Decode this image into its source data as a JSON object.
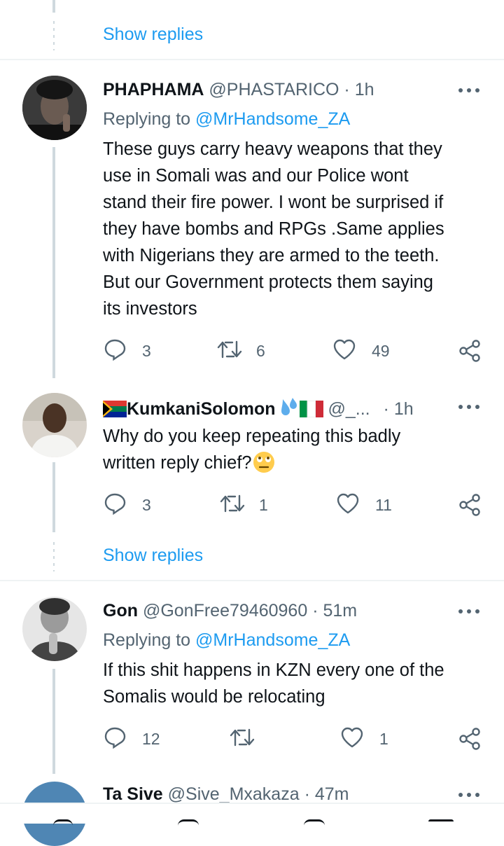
{
  "threads": [
    {
      "show_replies": "Show replies"
    },
    {
      "name": "PHAPHAMA",
      "handle": "@PHASTARICO",
      "time": "· 1h",
      "replying_prefix": "Replying to",
      "replying_to": "@MrHandsome_ZA",
      "text_lines": [
        "These guys carry heavy weapons that they",
        "use in Somali was and our Police wont",
        "stand their fire power. I wont be surprised if",
        "they have bombs and RPGs .Same applies",
        "with Nigerians they are armed to the teeth.",
        "But our Government protects them saying",
        "its investors"
      ],
      "replies": "3",
      "retweets": "6",
      "likes": "49"
    },
    {
      "name": "KumkaniSolomon",
      "handle": "@_...",
      "time": "· 1h",
      "text": "Why do you keep repeating this badly",
      "text2": "written reply chief?",
      "replies": "3",
      "retweets": "1",
      "likes": "11"
    },
    {
      "show_replies": "Show replies"
    },
    {
      "name": "Gon",
      "handle": "@GonFree79460960",
      "time": "· 51m",
      "replying_prefix": "Replying to",
      "replying_to": "@MrHandsome_ZA",
      "text_lines": [
        "If this shit happens in KZN every one of the",
        "Somalis would be relocating"
      ],
      "replies": "12",
      "retweets": "",
      "likes": "1"
    },
    {
      "name": "Ta Sive",
      "handle": "@Sive_Mxakaza",
      "time": "· 47m"
    }
  ],
  "icons": {
    "reply": "reply-icon",
    "retweet": "retweet-icon",
    "like": "heart-icon",
    "share": "share-icon",
    "more": "more-dots-icon"
  },
  "colors": {
    "link": "#1d9bf0",
    "muted": "#536471",
    "text": "#0f1419",
    "thread_line": "#cfd9de"
  }
}
